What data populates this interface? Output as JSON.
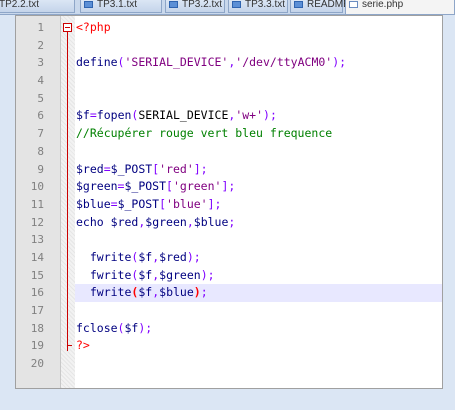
{
  "tabs": [
    {
      "label": "TP2.2.txt",
      "active": false
    },
    {
      "label": "TP3.1.txt",
      "active": false
    },
    {
      "label": "TP3.2.txt",
      "active": false
    },
    {
      "label": "TP3.3.txt",
      "active": false
    },
    {
      "label": "README",
      "active": false
    },
    {
      "label": "serie.php",
      "active": true
    }
  ],
  "editor": {
    "language": "php",
    "current_line": 16,
    "lines": [
      {
        "n": "1",
        "tokens": [
          [
            "tag",
            "<?php"
          ]
        ]
      },
      {
        "n": "2",
        "tokens": []
      },
      {
        "n": "3",
        "tokens": [
          [
            "k",
            "define"
          ],
          [
            "p",
            "("
          ],
          [
            "s",
            "'SERIAL_DEVICE'"
          ],
          [
            "p",
            ","
          ],
          [
            "s",
            "'/dev/ttyACM0'"
          ],
          [
            "p",
            ");"
          ]
        ]
      },
      {
        "n": "4",
        "tokens": []
      },
      {
        "n": "5",
        "tokens": []
      },
      {
        "n": "6",
        "tokens": [
          [
            "v",
            "$f"
          ],
          [
            "p",
            "="
          ],
          [
            "fn",
            "fopen"
          ],
          [
            "p",
            "("
          ],
          [
            "d",
            "SERIAL_DEVICE"
          ],
          [
            "p",
            ","
          ],
          [
            "s",
            "'w+'"
          ],
          [
            "p",
            ");"
          ]
        ]
      },
      {
        "n": "7",
        "tokens": [
          [
            "c",
            "//Récupérer rouge vert bleu frequence"
          ]
        ]
      },
      {
        "n": "8",
        "tokens": []
      },
      {
        "n": "9",
        "tokens": [
          [
            "v",
            "$red"
          ],
          [
            "p",
            "="
          ],
          [
            "v",
            "$_POST"
          ],
          [
            "p",
            "["
          ],
          [
            "s",
            "'red'"
          ],
          [
            "p",
            "];"
          ]
        ]
      },
      {
        "n": "10",
        "tokens": [
          [
            "v",
            "$green"
          ],
          [
            "p",
            "="
          ],
          [
            "v",
            "$_POST"
          ],
          [
            "p",
            "["
          ],
          [
            "s",
            "'green'"
          ],
          [
            "p",
            "];"
          ]
        ]
      },
      {
        "n": "11",
        "tokens": [
          [
            "v",
            "$blue"
          ],
          [
            "p",
            "="
          ],
          [
            "v",
            "$_POST"
          ],
          [
            "p",
            "["
          ],
          [
            "s",
            "'blue'"
          ],
          [
            "p",
            "];"
          ]
        ]
      },
      {
        "n": "12",
        "tokens": [
          [
            "k",
            "echo"
          ],
          [
            "d",
            " "
          ],
          [
            "v",
            "$red"
          ],
          [
            "p",
            ","
          ],
          [
            "v",
            "$green"
          ],
          [
            "p",
            ","
          ],
          [
            "v",
            "$blue"
          ],
          [
            "p",
            ";"
          ]
        ]
      },
      {
        "n": "13",
        "tokens": []
      },
      {
        "n": "14",
        "tokens": [
          [
            "d",
            "  "
          ],
          [
            "fn",
            "fwrite"
          ],
          [
            "p",
            "("
          ],
          [
            "v",
            "$f"
          ],
          [
            "p",
            ","
          ],
          [
            "v",
            "$red"
          ],
          [
            "p",
            ");"
          ]
        ]
      },
      {
        "n": "15",
        "tokens": [
          [
            "d",
            "  "
          ],
          [
            "fn",
            "fwrite"
          ],
          [
            "p",
            "("
          ],
          [
            "v",
            "$f"
          ],
          [
            "p",
            ","
          ],
          [
            "v",
            "$green"
          ],
          [
            "p",
            ");"
          ]
        ]
      },
      {
        "n": "16",
        "tokens": [
          [
            "d",
            "  "
          ],
          [
            "fn",
            "fwrite"
          ],
          [
            "hl",
            "("
          ],
          [
            "v",
            "$f"
          ],
          [
            "p",
            ","
          ],
          [
            "v",
            "$blue"
          ],
          [
            "hl",
            ")"
          ],
          [
            "p",
            ";"
          ]
        ]
      },
      {
        "n": "17",
        "tokens": []
      },
      {
        "n": "18",
        "tokens": [
          [
            "fn",
            "fclose"
          ],
          [
            "p",
            "("
          ],
          [
            "v",
            "$f"
          ],
          [
            "p",
            ");"
          ]
        ]
      },
      {
        "n": "19",
        "tokens": [
          [
            "tag",
            "?>"
          ]
        ]
      },
      {
        "n": "20",
        "tokens": []
      }
    ]
  }
}
